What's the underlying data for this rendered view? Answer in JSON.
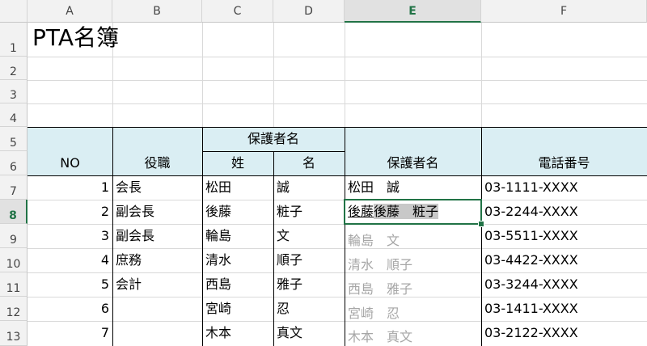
{
  "columns": [
    "A",
    "B",
    "C",
    "D",
    "E",
    "F"
  ],
  "rows": [
    "1",
    "2",
    "3",
    "4",
    "5",
    "6",
    "7",
    "8",
    "9",
    "10",
    "11",
    "12",
    "13"
  ],
  "title": "PTA名簿",
  "headers": {
    "no": "NO",
    "role": "役職",
    "guardian_group": "保護者名",
    "last_name": "姓",
    "first_name": "名",
    "guardian_full": "保護者名",
    "phone": "電話番号"
  },
  "records": [
    {
      "no": "1",
      "role": "会長",
      "last": "松田",
      "first": "誠",
      "full": "松田　誠",
      "phone": "03-1111-XXXX"
    },
    {
      "no": "2",
      "role": "副会長",
      "last": "後藤",
      "first": "粧子",
      "full": "",
      "phone": "03-2244-XXXX"
    },
    {
      "no": "3",
      "role": "副会長",
      "last": "輪島",
      "first": "文",
      "full": "",
      "phone": "03-5511-XXXX"
    },
    {
      "no": "4",
      "role": "庶務",
      "last": "清水",
      "first": "順子",
      "full": "",
      "phone": "03-4422-XXXX"
    },
    {
      "no": "5",
      "role": "会計",
      "last": "西島",
      "first": "雅子",
      "full": "",
      "phone": "03-3244-XXXX"
    },
    {
      "no": "6",
      "role": "",
      "last": "宮崎",
      "first": "忍",
      "full": "",
      "phone": "03-1411-XXXX"
    },
    {
      "no": "7",
      "role": "",
      "last": "木本",
      "first": "真文",
      "full": "",
      "phone": "03-2122-XXXX"
    }
  ],
  "editing": {
    "typed": "後藤",
    "suggestion": "後藤　粧子"
  },
  "flash_fill_preview": [
    "輪島　文",
    "清水　順子",
    "西島　雅子",
    "宮崎　忍",
    "木本　真文"
  ],
  "colors": {
    "header_fill": "#daeef3",
    "active_accent": "#217346",
    "preview_text": "#a6a6a6"
  }
}
